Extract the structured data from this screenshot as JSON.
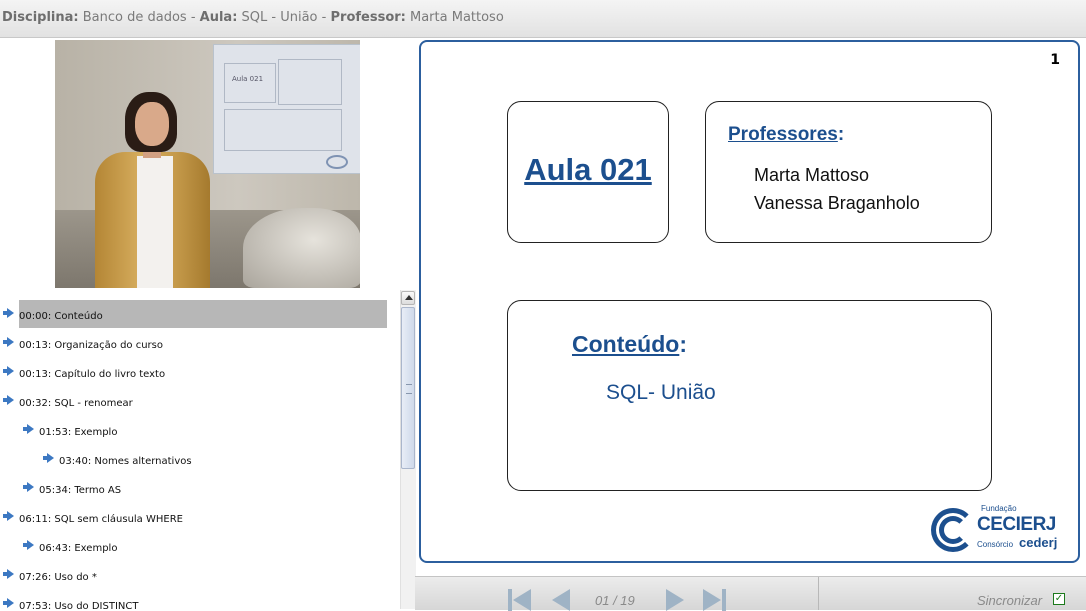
{
  "header": {
    "disciplina_label": "Disciplina:",
    "disciplina_value": "Banco de dados",
    "sep1": "-",
    "aula_label": "Aula:",
    "aula_value": "SQL - União",
    "sep2": "-",
    "professor_label": "Professor:",
    "professor_value": "Marta Mattoso"
  },
  "video": {
    "screen_text": "Aula 021"
  },
  "toc": {
    "items": [
      {
        "label": "00:00: Conteúdo",
        "level": 0,
        "selected": true
      },
      {
        "label": "00:13: Organização do curso",
        "level": 0
      },
      {
        "label": "00:13: Capítulo do livro texto",
        "level": 0
      },
      {
        "label": "00:32: SQL - renomear",
        "level": 0
      },
      {
        "label": "01:53: Exemplo",
        "level": 1
      },
      {
        "label": "03:40: Nomes alternativos",
        "level": 2
      },
      {
        "label": "05:34: Termo AS",
        "level": 1
      },
      {
        "label": "06:11: SQL sem cláusula WHERE",
        "level": 0
      },
      {
        "label": "06:43: Exemplo",
        "level": 1
      },
      {
        "label": "07:26: Uso do *",
        "level": 0
      },
      {
        "label": "07:53: Uso do DISTINCT",
        "level": 0
      }
    ]
  },
  "slide": {
    "number": "1",
    "aula_title": "Aula 021",
    "professores_title": "Professores",
    "professores_colon": ":",
    "professors": [
      "Marta Mattoso",
      "Vanessa Braganholo"
    ],
    "conteudo_title": "Conteúdo",
    "conteudo_colon": ":",
    "conteudo_text": "SQL- União",
    "logo": {
      "fundacao": "Fundação",
      "name": "CECIERJ",
      "consorcio": "Consórcio",
      "cederj": "cederj"
    }
  },
  "navigation": {
    "page_indicator": "01 / 19",
    "sync_label": "Sincronizar",
    "sync_checked": true,
    "sync_check_glyph": "✓"
  },
  "colors": {
    "accent_blue": "#1c4f8e",
    "slide_border": "#2c5f9e",
    "arrow_blue": "#3c78c2",
    "selected_row": "#b7b7b7"
  }
}
